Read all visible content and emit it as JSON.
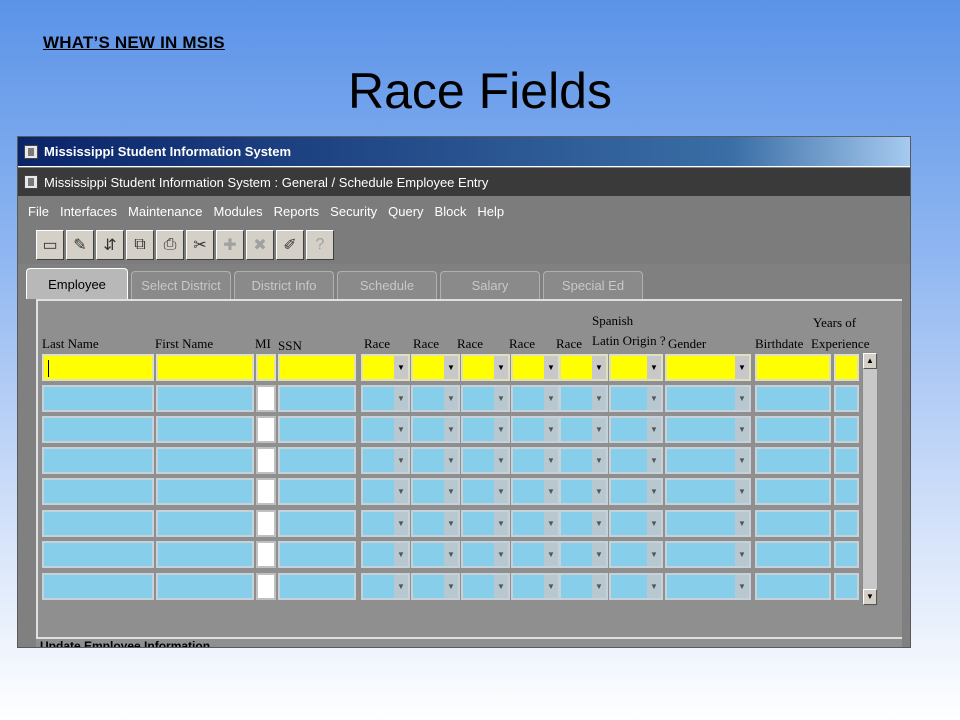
{
  "slide": {
    "kicker": "WHAT’S NEW IN MSIS",
    "title": "Race Fields"
  },
  "window": {
    "title": "Mississippi Student Information System",
    "subtitle": "Mississippi Student Information System : General / Schedule Employee Entry"
  },
  "menu": [
    "File",
    "Interfaces",
    "Maintenance",
    "Modules",
    "Reports",
    "Security",
    "Query",
    "Block",
    "Help"
  ],
  "toolbar": {
    "icons": [
      "save-icon",
      "edit-icon",
      "sort-icon",
      "print-preview-icon",
      "print-icon",
      "clear-icon",
      "insert-icon",
      "delete-icon",
      "edit-pencil-icon",
      "help-icon"
    ],
    "glyphs": [
      "▭",
      "✎",
      "⇵",
      "⧉",
      "⎙",
      "✂",
      "✚",
      "✖",
      "✐",
      "?"
    ]
  },
  "tabs": [
    "Employee",
    "Select District",
    "District Info",
    "Schedule",
    "Salary",
    "Special Ed"
  ],
  "columns": {
    "last_name": "Last Name",
    "first_name": "First Name",
    "mi": "MI",
    "ssn": "SSN",
    "race1": "Race",
    "race2": "Race",
    "race3": "Race",
    "race4": "Race",
    "race5": "Race",
    "spanish_line1": "Spanish",
    "spanish_line2": "Latin Origin ?",
    "gender": "Gender",
    "birthdate": "Birthdate",
    "years_line1": "Years of",
    "years_line2": "Experience"
  },
  "status": {
    "text": "Update Employee Information"
  },
  "colors": {
    "active_row": "#ffff00",
    "row": "#87ceeb"
  }
}
